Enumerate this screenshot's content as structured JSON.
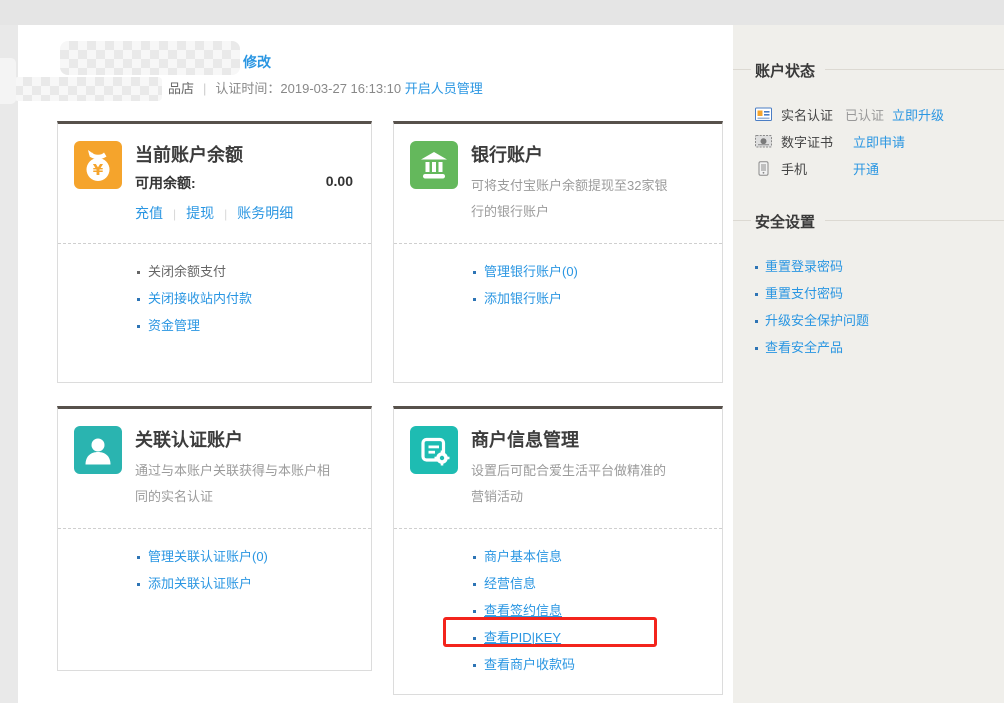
{
  "colors": {
    "accent_blue": "#2a96e2",
    "highlight_red": "#f3241c",
    "card_top_border": "#57514b",
    "icon_balance": "#f5a42c",
    "icon_bank": "#64b85c",
    "icon_linked": "#2ab4b0",
    "icon_merchant": "#1ebcb2"
  },
  "header": {
    "modify": "修改",
    "shop_suffix": "品店",
    "divider": "|",
    "cert_label": "认证时间：",
    "cert_time": "2019-03-27 16:13:10",
    "staff_link": "开启人员管理"
  },
  "cards": {
    "balance": {
      "title": "当前账户余额",
      "label": "可用余额:",
      "value": "0.00",
      "quick": [
        "充值",
        "提现",
        "账务明细"
      ],
      "quick_sep": "|",
      "items": [
        "关闭余额支付",
        "关闭接收站内付款",
        "资金管理"
      ]
    },
    "bank": {
      "title": "银行账户",
      "desc": "可将支付宝账户余额提现至32家银行的银行账户",
      "items": [
        "管理银行账户(0)",
        "添加银行账户"
      ]
    },
    "linked": {
      "title": "关联认证账户",
      "desc": "通过与本账户关联获得与本账户相同的实名认证",
      "items": [
        "管理关联认证账户(0)",
        "添加关联认证账户"
      ]
    },
    "merchant": {
      "title": "商户信息管理",
      "desc": "设置后可配合爱生活平台做精准的营销活动",
      "items": [
        "商户基本信息",
        "经营信息",
        "查看签约信息",
        "查看PID|KEY",
        "查看商户收款码"
      ]
    }
  },
  "sidebar": {
    "status_title": "账户状态",
    "rows": [
      {
        "label": "实名认证",
        "status": "已认证",
        "link": "立即升级"
      },
      {
        "label": "数字证书",
        "status": "",
        "link": "立即申请"
      },
      {
        "label": "手机",
        "status": "",
        "link": "开通"
      }
    ],
    "security_title": "安全设置",
    "links": [
      "重置登录密码",
      "重置支付密码",
      "升级安全保护问题",
      "查看安全产品"
    ]
  }
}
